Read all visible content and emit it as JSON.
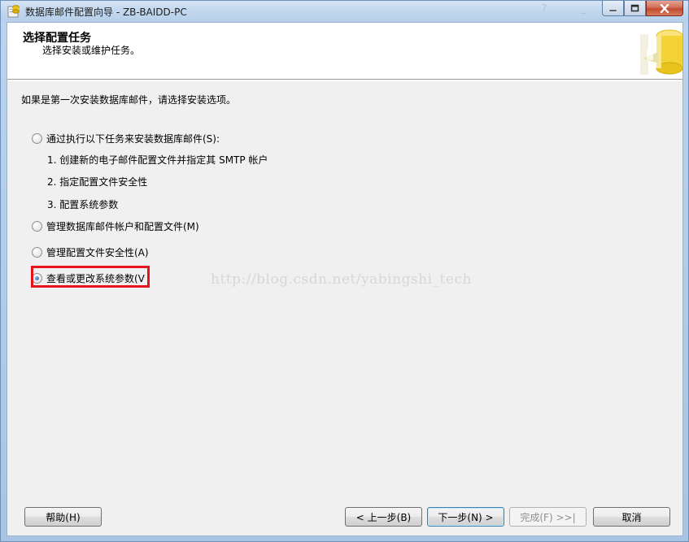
{
  "window": {
    "title": "数据库邮件配置向导 - ZB-BAIDD-PC"
  },
  "banner": {
    "title": "选择配置任务",
    "subtitle": "选择安装或维护任务。"
  },
  "prompt": "如果是第一次安装数据库邮件，请选择安装选项。",
  "options": [
    {
      "label": "通过执行以下任务来安装数据库邮件(S):",
      "checked": false
    },
    {
      "label": "管理数据库邮件帐户和配置文件(M)",
      "checked": false
    },
    {
      "label": "管理配置文件安全性(A)",
      "checked": false
    },
    {
      "label": "查看或更改系统参数(V",
      "checked": true
    }
  ],
  "steps": [
    "1. 创建新的电子邮件配置文件并指定其 SMTP 帐户",
    "2. 指定配置文件安全性",
    "3. 配置系统参数"
  ],
  "watermark": "http://blog.csdn.net/yabingshi_tech",
  "buttons": {
    "help": "帮助(H)",
    "back": "< 上一步(B)",
    "next": "下一步(N) >",
    "finish": "完成(F) >>|",
    "cancel": "取消"
  },
  "colors": {
    "highlight_border": "#e8121c",
    "close_button": "#c14a2e"
  }
}
